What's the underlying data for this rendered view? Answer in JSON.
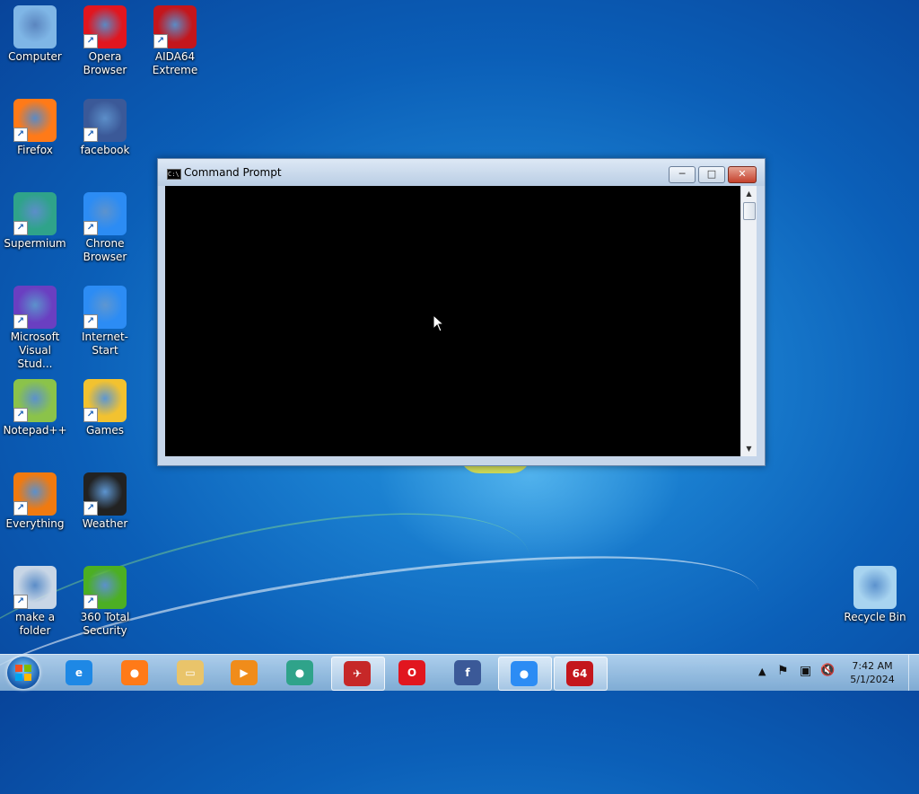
{
  "desktop": {
    "icons": [
      {
        "label": "Computer",
        "icon": "computer-icon",
        "color": "#7fb6e6"
      },
      {
        "label": "Opera Browser",
        "icon": "opera-icon",
        "color": "#e1161f"
      },
      {
        "label": "AIDA64 Extreme",
        "icon": "aida64-icon",
        "color": "#c4161c"
      },
      {
        "label": "Firefox",
        "icon": "firefox-icon",
        "color": "#ff7a18"
      },
      {
        "label": "facebook",
        "icon": "facebook-icon",
        "color": "#3b5998"
      },
      {
        "label": "Supermium",
        "icon": "supermium-icon",
        "color": "#2fa38a"
      },
      {
        "label": "Chrone Browser",
        "icon": "chrome-icon",
        "color": "#2c8cf4"
      },
      {
        "label": "Microsoft Visual Stud...",
        "icon": "visual-studio-icon",
        "color": "#6a3fc1"
      },
      {
        "label": "Internet-Start",
        "icon": "chrome-icon",
        "color": "#2c8cf4"
      },
      {
        "label": "Notepad++",
        "icon": "notepadpp-icon",
        "color": "#8bc34a"
      },
      {
        "label": "Games",
        "icon": "games-icon",
        "color": "#f2c230"
      },
      {
        "label": "Everything",
        "icon": "everything-icon",
        "color": "#f07a10"
      },
      {
        "label": "Weather",
        "icon": "weather-icon",
        "color": "#222222"
      },
      {
        "label": "make a folder",
        "icon": "settings-icon",
        "color": "#c8d6e6"
      },
      {
        "label": "360 Total Security",
        "icon": "security-icon",
        "color": "#4caf23"
      },
      {
        "label": "Recycle Bin",
        "icon": "recycle-bin-icon",
        "color": "#a8d4f0"
      }
    ]
  },
  "window": {
    "title": "Command Prompt",
    "app_icon_text": "C:\\",
    "minimize": "─",
    "maximize": "□",
    "close": "✕"
  },
  "taskbar": {
    "items": [
      {
        "name": "internet-explorer",
        "glyph": "e",
        "color": "#1e88e5",
        "active": false
      },
      {
        "name": "firefox",
        "glyph": "●",
        "color": "#ff7a18",
        "active": false
      },
      {
        "name": "file-explorer",
        "glyph": "▭",
        "color": "#e9c46a",
        "active": false
      },
      {
        "name": "media-player",
        "glyph": "▶",
        "color": "#f08c1a",
        "active": false
      },
      {
        "name": "supermium",
        "glyph": "●",
        "color": "#2fa38a",
        "active": false
      },
      {
        "name": "command-prompt",
        "glyph": "✈",
        "color": "#c62828",
        "active": true
      },
      {
        "name": "opera",
        "glyph": "O",
        "color": "#e1161f",
        "active": false
      },
      {
        "name": "facebook",
        "glyph": "f",
        "color": "#3b5998",
        "active": false
      },
      {
        "name": "chrome",
        "glyph": "●",
        "color": "#2c8cf4",
        "active": true
      },
      {
        "name": "aida64",
        "glyph": "64",
        "color": "#c4161c",
        "active": true
      }
    ],
    "tray": {
      "show_hidden": "▲",
      "flag": "⚑",
      "network": "▣",
      "volume": "🔇"
    },
    "clock": {
      "time": "7:42 AM",
      "date": "5/1/2024"
    }
  }
}
